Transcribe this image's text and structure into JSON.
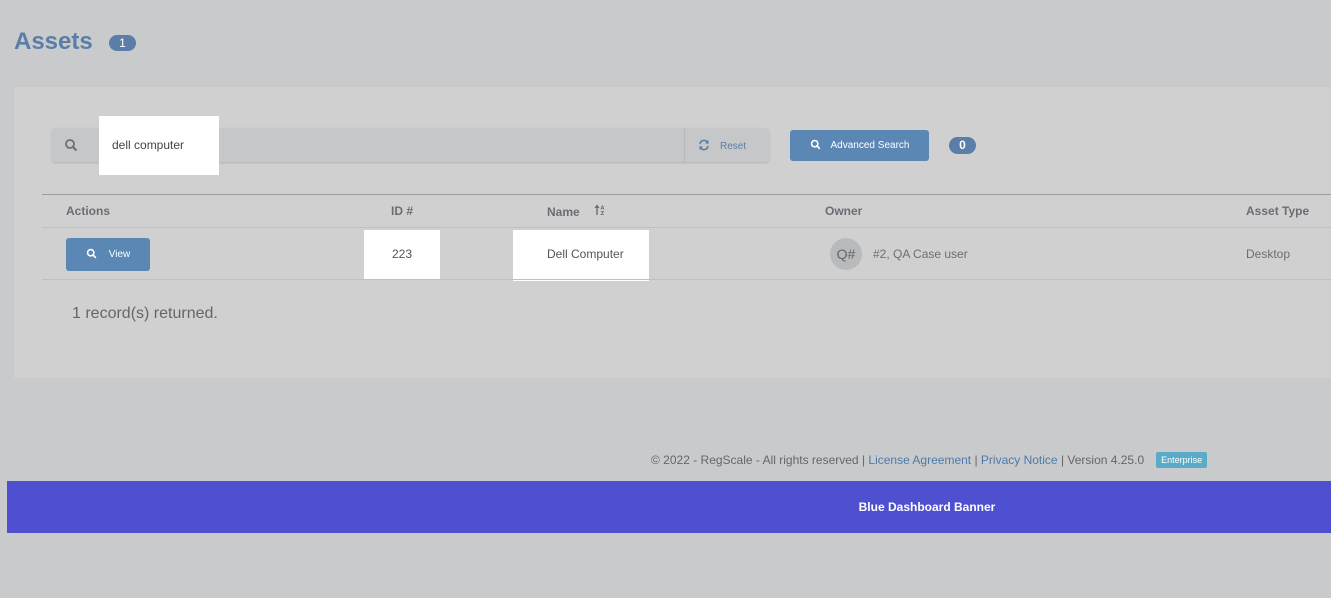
{
  "header": {
    "title": "Assets",
    "count": "1"
  },
  "search": {
    "value": "dell computer",
    "reset_label": "Reset"
  },
  "advanced_search": {
    "label": "Advanced Search",
    "filter_count": "0"
  },
  "table": {
    "columns": [
      "Actions",
      "ID #",
      "Name",
      "Owner",
      "Asset Type"
    ],
    "rows": [
      {
        "action_label": "View",
        "id": "223",
        "name": "Dell Computer",
        "owner_avatar": "Q#",
        "owner": "#2, QA Case user",
        "asset_type": "Desktop"
      }
    ]
  },
  "records_text": "1 record(s) returned.",
  "footer": {
    "copyright": "© 2022 - RegScale - All rights reserved | ",
    "license_link": "License Agreement",
    "sep1": " | ",
    "privacy_link": "Privacy Notice",
    "version": " | Version 4.25.0",
    "edition_badge": "Enterprise"
  },
  "banner": {
    "text": "Blue Dashboard Banner"
  },
  "colors": {
    "accent": "#5a87b4",
    "banner": "#4f50d0",
    "badge": "#5aaac9",
    "background": "#c9cacc"
  }
}
